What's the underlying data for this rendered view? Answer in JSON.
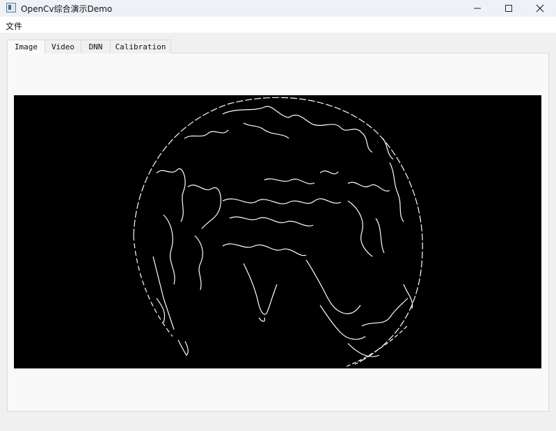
{
  "window": {
    "title": "OpenCv综合演示Demo"
  },
  "menu": {
    "items": [
      "文件"
    ]
  },
  "tabs": [
    {
      "label": "Image",
      "active": true
    },
    {
      "label": "Video",
      "active": false
    },
    {
      "label": "DNN",
      "active": false
    },
    {
      "label": "Calibration",
      "active": false
    }
  ],
  "image_view": {
    "content": "edge-detected earth globe",
    "background": "#000000",
    "stroke": "#ffffff"
  }
}
